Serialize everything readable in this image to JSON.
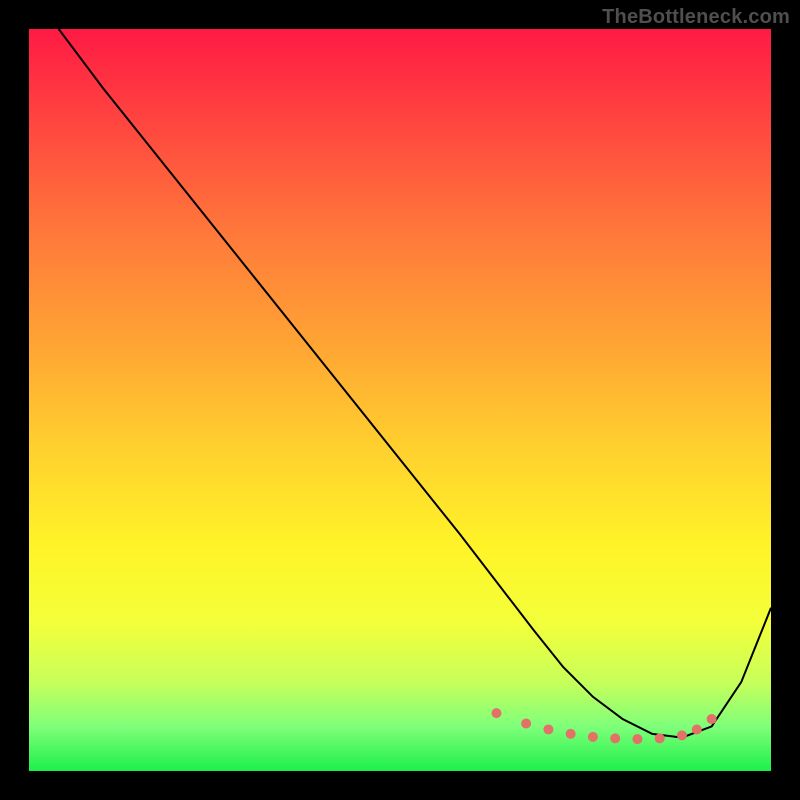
{
  "watermark": "TheBottleneck.com",
  "chart_data": {
    "type": "line",
    "title": "",
    "xlabel": "",
    "ylabel": "",
    "xlim": [
      0,
      100
    ],
    "ylim": [
      0,
      100
    ],
    "series": [
      {
        "name": "curve",
        "x": [
          4,
          10,
          20,
          30,
          40,
          50,
          58,
          63,
          68,
          72,
          76,
          80,
          84,
          88,
          92,
          96,
          100
        ],
        "y": [
          100,
          92,
          79.5,
          67,
          54.5,
          42,
          32,
          25.5,
          19,
          14,
          10,
          7,
          5,
          4.5,
          6,
          12,
          22
        ]
      }
    ],
    "markers": {
      "name": "highlight-points",
      "x": [
        63,
        67,
        70,
        73,
        76,
        79,
        82,
        85,
        88,
        90,
        92
      ],
      "y": [
        7.8,
        6.4,
        5.6,
        5.0,
        4.6,
        4.4,
        4.3,
        4.4,
        4.8,
        5.6,
        7.0
      ]
    },
    "colors": {
      "curve": "#000000",
      "markers": "#e37168"
    }
  }
}
